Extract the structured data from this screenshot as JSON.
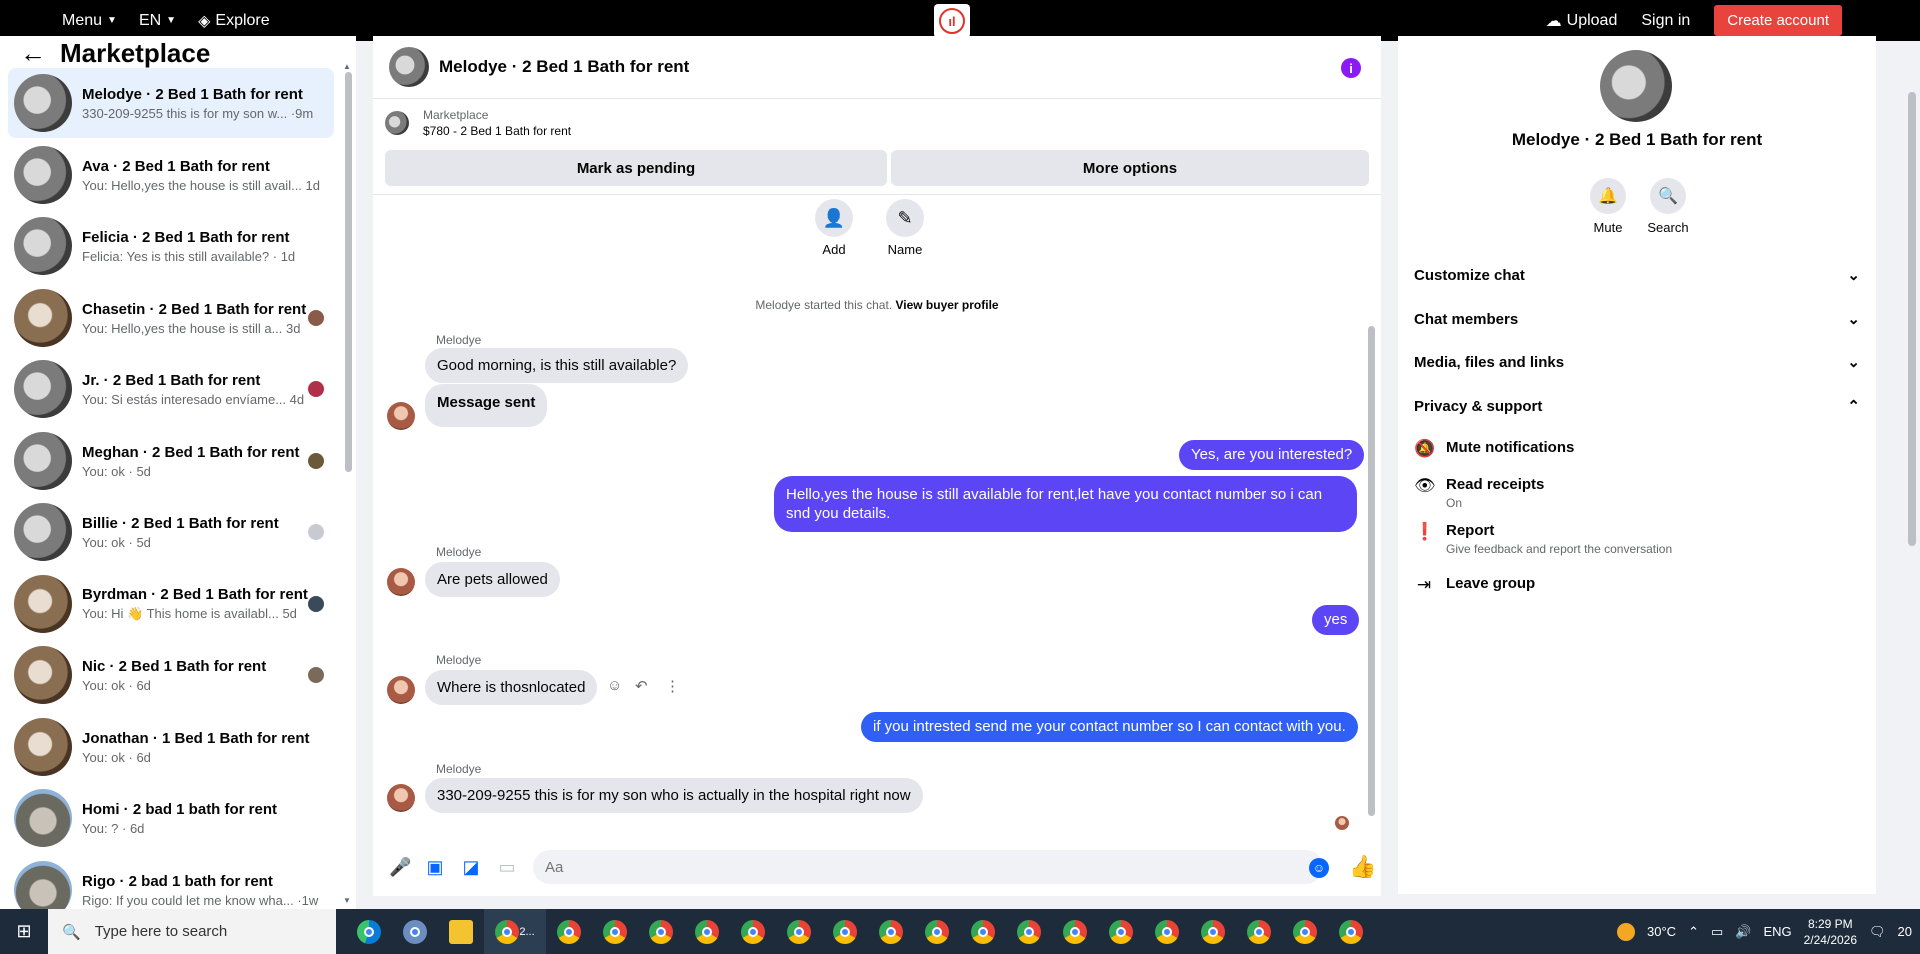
{
  "topbar": {
    "menu": "Menu",
    "lang": "EN",
    "explore": "Explore",
    "upload": "Upload",
    "sign_in": "Sign in",
    "create_account": "Create account"
  },
  "sidebar": {
    "title": "Marketplace",
    "conversations": [
      {
        "name": "Melodye · 2 Bed 1 Bath for rent",
        "preview": "330-209-9255 this is for my son w... ·9m"
      },
      {
        "name": "Ava · 2 Bed 1 Bath for rent",
        "preview": "You: Hello,yes the house is still avail... 1d"
      },
      {
        "name": "Felicia · 2 Bed 1 Bath for rent",
        "preview": "Felicia: Yes is this still available? · 1d"
      },
      {
        "name": "Chasetin · 2 Bed 1 Bath for rent",
        "preview": "You: Hello,yes the house is still a... 3d"
      },
      {
        "name": "Jr. · 2 Bed 1 Bath for rent",
        "preview": "You: Si estás interesado envíame... 4d"
      },
      {
        "name": "Meghan · 2 Bed 1 Bath for rent",
        "preview": "You: ok · 5d"
      },
      {
        "name": "Billie · 2 Bed 1 Bath for rent",
        "preview": "You: ok · 5d"
      },
      {
        "name": "Byrdman · 2 Bed 1 Bath for rent",
        "preview": "You: Hi 👋 This home is availabl... 5d"
      },
      {
        "name": "Nic · 2 Bed 1 Bath for rent",
        "preview": "You: ok · 6d"
      },
      {
        "name": "Jonathan · 1 Bed 1 Bath for rent",
        "preview": "You: ok · 6d"
      },
      {
        "name": "Homi · 2 bad 1 bath for rent",
        "preview": "You: ? · 6d"
      },
      {
        "name": "Rigo · 2 bad 1 bath for rent",
        "preview": "Rigo: If you could let me know wha... ·1w"
      }
    ]
  },
  "chat": {
    "header_name": "Melodye · 2 Bed 1 Bath for rent",
    "listing_source": "Marketplace",
    "listing_price": "$780 - 2 Bed 1 Bath for rent",
    "mark_pending": "Mark as pending",
    "more_options": "More options",
    "add_label": "Add",
    "name_label": "Name",
    "started_text": "Melodye started this chat.",
    "view_profile": "View buyer profile",
    "sender": "Melodye",
    "messages": {
      "m1": "Good morning, is this still available?",
      "m2": "Message sent",
      "m3": "Yes, are you interested?",
      "m4": "Hello,yes the house is still available for rent,let have you contact number so i can snd you details.",
      "m5": "Are pets allowed",
      "m6": "yes",
      "m7": "Where is thosnlocated",
      "m8": "if you intrested send me your contact number  so I can contact with you.",
      "m9": "330-209-9255 this is for my son who is actually in the hospital right now"
    },
    "composer_placeholder": "Aa"
  },
  "details": {
    "name": "Melodye · 2 Bed 1 Bath for rent",
    "mute": "Mute",
    "search": "Search",
    "sections": [
      "Customize chat",
      "Chat members",
      "Media, files and links",
      "Privacy & support"
    ],
    "mute_notifications": "Mute notifications",
    "read_receipts": "Read receipts",
    "read_receipts_state": "On",
    "report": "Report",
    "report_desc": "Give feedback and report the conversation",
    "leave_group": "Leave group"
  },
  "taskbar": {
    "search_placeholder": "Type here to search",
    "active_app": "2...",
    "temp": "30°C",
    "lang": "ENG",
    "time": "8:29 PM",
    "date": "2/24/2026",
    "notif": "20"
  },
  "colors": {
    "outgoing": "#5b45f5",
    "incoming": "#e4e6eb",
    "accent": "#0866ff",
    "create_button": "#e8433c"
  }
}
